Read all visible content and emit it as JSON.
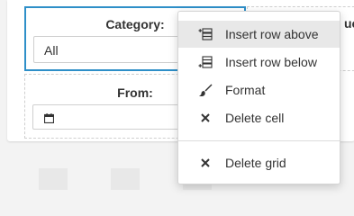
{
  "form": {
    "category_label": "Category:",
    "category_value": "All",
    "from_label": "From:",
    "right_label_fragment": "uct"
  },
  "context_menu": {
    "items": [
      {
        "label": "Insert row above",
        "icon": "insert-row-above-icon"
      },
      {
        "label": "Insert row below",
        "icon": "insert-row-below-icon"
      },
      {
        "label": "Format",
        "icon": "paintbrush-icon"
      },
      {
        "label": "Delete cell",
        "icon": "close-icon"
      }
    ],
    "footer_item": {
      "label": "Delete grid",
      "icon": "close-icon"
    }
  },
  "colors": {
    "selected_border": "#2e8fc8",
    "hover_background": "#e8e8e8"
  }
}
